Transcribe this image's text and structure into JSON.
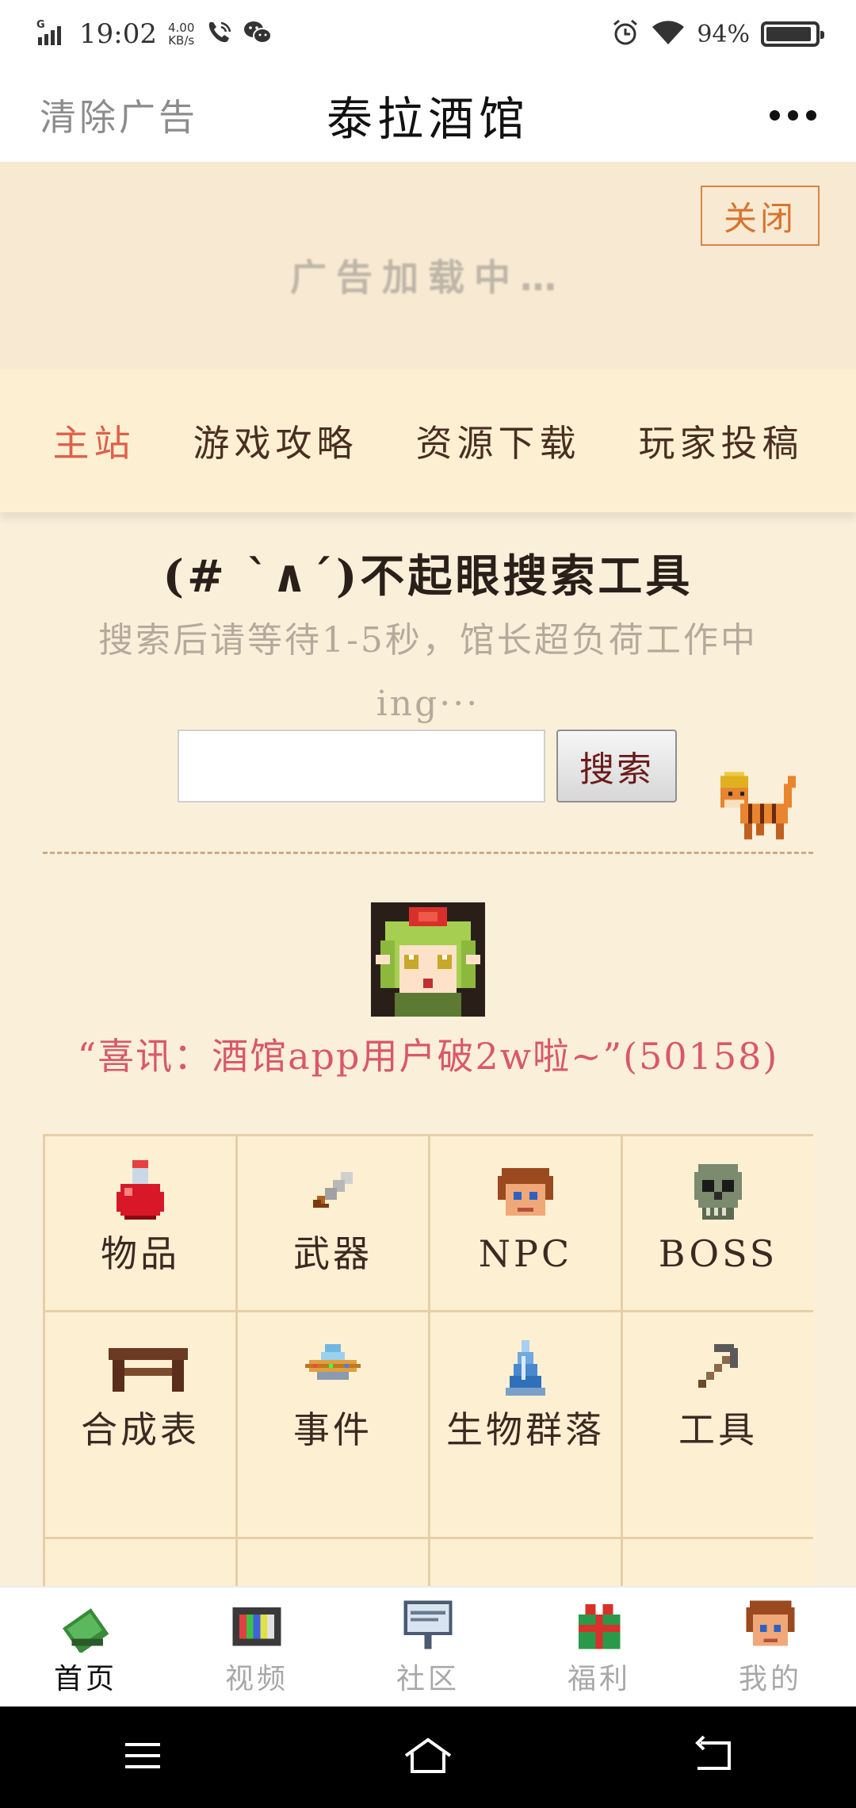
{
  "status_bar": {
    "network": "G",
    "time": "19:02",
    "speed_value": "4.00",
    "speed_unit": "KB/s",
    "battery": "94%",
    "battery_level": 0.94
  },
  "title_bar": {
    "clear_ads": "清除广告",
    "title": "泰拉酒馆",
    "more_icon": "more-dots-icon"
  },
  "ad": {
    "close_label": "关闭",
    "loading_text": "广告加载中…"
  },
  "nav_tabs": [
    {
      "label": "主站",
      "active": true
    },
    {
      "label": "游戏攻略",
      "active": false
    },
    {
      "label": "资源下载",
      "active": false
    },
    {
      "label": "玩家投稿",
      "active": false
    }
  ],
  "search": {
    "title": "(# `∧´)不起眼搜索工具",
    "hint": "搜索后请等待1-5秒，馆长超负荷工作中ing···",
    "value": "",
    "button": "搜索"
  },
  "news": "“喜讯：酒馆app用户破2w啦~”(50158)",
  "categories": [
    {
      "label": "物品",
      "icon": "potion-icon"
    },
    {
      "label": "武器",
      "icon": "sword-icon"
    },
    {
      "label": "NPC",
      "icon": "npc-head-icon"
    },
    {
      "label": "BOSS",
      "icon": "skull-icon"
    },
    {
      "label": "合成表",
      "icon": "workbench-icon"
    },
    {
      "label": "事件",
      "icon": "ufo-icon"
    },
    {
      "label": "生物群落",
      "icon": "crystal-icon"
    },
    {
      "label": "工具",
      "icon": "pickaxe-icon"
    }
  ],
  "bottom_tabs": [
    {
      "label": "首页",
      "icon": "book-icon",
      "active": true
    },
    {
      "label": "视频",
      "icon": "tv-icon",
      "active": false
    },
    {
      "label": "社区",
      "icon": "sign-board-icon",
      "active": false
    },
    {
      "label": "福利",
      "icon": "gift-icon",
      "active": false
    },
    {
      "label": "我的",
      "icon": "profile-head-icon",
      "active": false
    }
  ],
  "colors": {
    "accent": "#e0604a",
    "news": "#d9586a",
    "background": "#faefd9",
    "nav_background": "#fdf0d2"
  }
}
